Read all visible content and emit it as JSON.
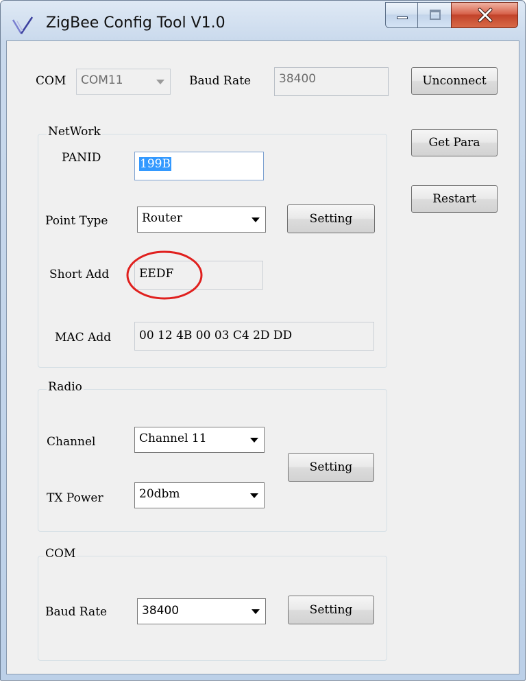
{
  "window": {
    "title": "ZigBee Config Tool V1.0"
  },
  "top": {
    "com_label": "COM",
    "com_value": "COM11",
    "baud_label": "Baud Rate",
    "baud_value": "38400",
    "unconnect_label": "Unconnect",
    "get_para_label": "Get Para",
    "restart_label": "Restart"
  },
  "network": {
    "title": "NetWork",
    "panid_label": "PANID",
    "panid_value": "199B",
    "point_type_label": "Point Type",
    "point_type_value": "Router",
    "setting_label": "Setting",
    "short_add_label": "Short Add",
    "short_add_value": "EEDF",
    "mac_add_label": "MAC Add",
    "mac_add_value": "00 12 4B 00 03 C4 2D DD"
  },
  "radio": {
    "title": "Radio",
    "channel_label": "Channel",
    "channel_value": "Channel 11",
    "tx_power_label": "TX Power",
    "tx_power_value": "20dbm",
    "setting_label": "Setting"
  },
  "com_group": {
    "title": "COM",
    "baud_label": "Baud Rate",
    "baud_value": "38400",
    "setting_label": "Setting"
  },
  "icons": {
    "app": "zigbee-app-icon",
    "minimize": "minimize-icon",
    "maximize": "maximize-icon",
    "close": "close-icon",
    "annotation": "red-circle-annotation"
  },
  "colors": {
    "annotation": "#e0201e",
    "close_button": "#c8452c",
    "selection": "#3399ff"
  }
}
